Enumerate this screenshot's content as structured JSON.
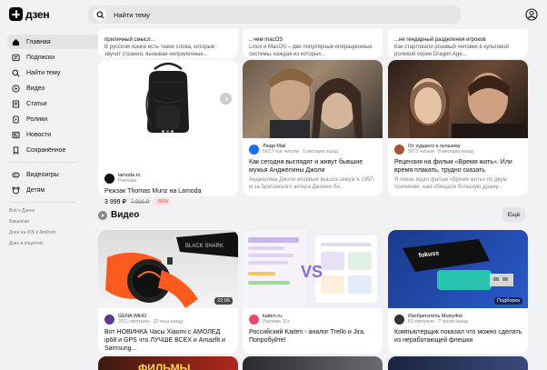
{
  "header": {
    "logo_text": "дзен",
    "search_placeholder": "Найти тему"
  },
  "sidebar": {
    "items": [
      {
        "label": "Главная",
        "icon": "home-icon"
      },
      {
        "label": "Подписки",
        "icon": "subscriptions-icon"
      },
      {
        "label": "Найти тему",
        "icon": "find-topic-icon"
      },
      {
        "label": "Видео",
        "icon": "video-icon"
      },
      {
        "label": "Статьи",
        "icon": "articles-icon"
      },
      {
        "label": "Ролики",
        "icon": "clips-icon"
      },
      {
        "label": "Новости",
        "icon": "news-icon"
      },
      {
        "label": "Сохранённое",
        "icon": "bookmark-icon"
      }
    ],
    "extra_items": [
      {
        "label": "Видеоигры",
        "icon": "gamepad-icon"
      },
      {
        "label": "Детям",
        "icon": "kids-icon"
      }
    ],
    "footer_links": [
      "Всё о Дзене",
      "Вакансии",
      "Дзен на iOS и Android",
      "Дзен в соцсетях"
    ]
  },
  "top_cards": [
    {
      "text": "приличный смысл..."
    },
    {
      "text": "В русском языке есть такие слова, которые звучат странно, вызывая неприличные..."
    },
    {
      "text": "...чем macOS"
    },
    {
      "text": "Linux и MacOS – две популярные операционные системы, каждая из которых..."
    },
    {
      "text": "...не гендарный разделения игроков"
    },
    {
      "text": "Как стартовали розовый человек в культовой ролевой серии Dragon Age..."
    }
  ],
  "cards": [
    {
      "source": "lamoda.ru",
      "meta": "Реклама",
      "title": "Рюкзак Thomas Munz на Lamoda",
      "price": "3 999 ₽",
      "old_price": "7 999 ₽",
      "discount": "-50%"
    },
    {
      "source": "Люди Mail",
      "meta": "562,7 тыс читали · 5 месяцев назад",
      "title": "Как сегодня выглядят и живут бывшие мужья Анджелины Джоли",
      "desc": "Анджелина Джоли впервые вышла замуж в 1997-м за британского актера Джонни Ли..."
    },
    {
      "source": "От худшего к лучшему",
      "meta": "5973 читали · 8 месяцев назад",
      "title": "Рецензия на фильм «Время жить». Или время плакать, трудно сказать",
      "desc": "Я очень ждал фильм «Время жить» по двум причинам: нам обещали большую драму..."
    }
  ],
  "video_section": {
    "title": "Видео",
    "more_label": "Ещё",
    "videos": [
      {
        "source": "GENA IMHO",
        "meta": "2011 смотрели · 22 часа назад",
        "title": "Вот НОВИНКА Часы Xiaomi с АМОЛЕД ip68 и GPS что ЛУЧШЕ ВСЕХ и Amazfit и Samsung...",
        "duration": "22:06",
        "badge": ""
      },
      {
        "source": "kaiten.ru",
        "meta": "Реклама 16+",
        "title": "Российский Kaiten - аналог Trello и Jira. Попробуйте!",
        "duration": "",
        "badge": ""
      },
      {
        "source": "Изобретатель Musiy4ok",
        "meta": "81 смотрели · 7 часов назад",
        "title": "Компьютерщик показал что можно сделать из неработающей флешки",
        "duration": "",
        "badge": "Подборка"
      }
    ]
  },
  "colors": {
    "background": "#f2f2f4",
    "card": "#ffffff",
    "accent_red": "#e33333"
  }
}
